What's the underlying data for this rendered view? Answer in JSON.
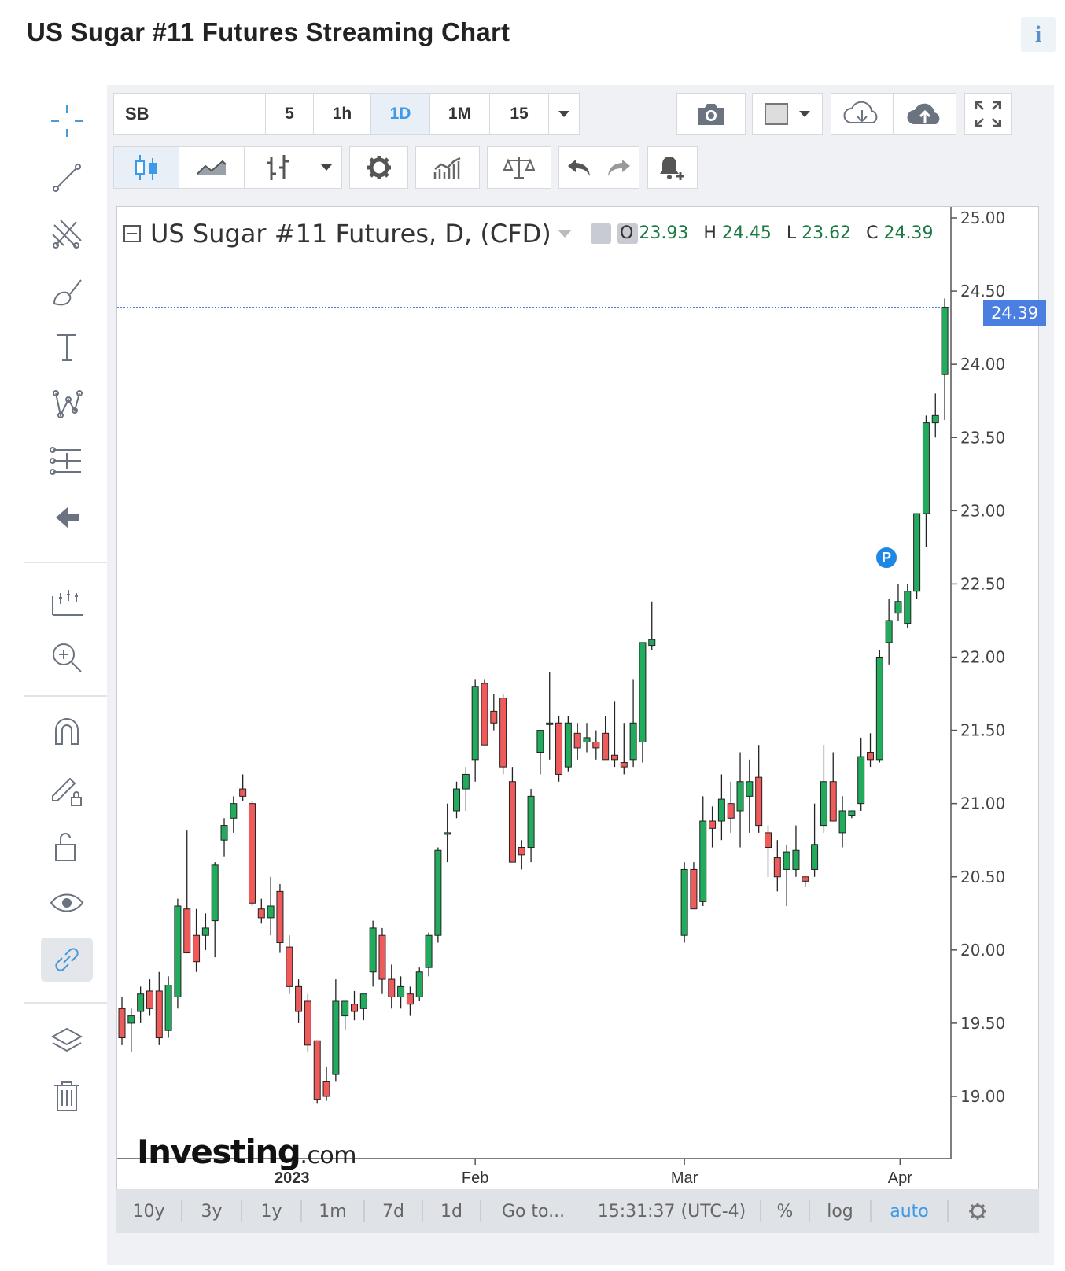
{
  "page": {
    "title": "US Sugar #11 Futures Streaming Chart",
    "info_icon": "i"
  },
  "toolbar": {
    "symbol": "SB",
    "intervals": [
      "5",
      "1h",
      "1D",
      "1M",
      "15"
    ],
    "active_interval": "1D"
  },
  "legend": {
    "title": "US Sugar #11 Futures, D, (CFD)",
    "o_label": "O",
    "o_value": "23.93",
    "h_label": "H",
    "h_value": "24.45",
    "l_label": "L",
    "l_value": "23.62",
    "c_label": "C",
    "c_value": "24.39"
  },
  "price_tag": "24.39",
  "marker_label": "P",
  "watermark": {
    "main": "Investing",
    "suffix": ".com"
  },
  "bottom_bar": {
    "ranges": [
      "10y",
      "3y",
      "1y",
      "1m",
      "7d",
      "1d"
    ],
    "goto": "Go to...",
    "time": "15:31:37 (UTC-4)",
    "percent": "%",
    "log": "log",
    "auto": "auto"
  },
  "colors": {
    "up": "#22ab5c",
    "down": "#ef5b5b",
    "accent": "#3d9ae8",
    "price_tag": "#4a7ee0"
  },
  "chart_data": {
    "type": "candlestick",
    "title": "US Sugar #11 Futures, D, (CFD)",
    "y_tick_labels": [
      "19.00",
      "19.50",
      "20.00",
      "20.50",
      "21.00",
      "21.50",
      "22.00",
      "22.50",
      "23.00",
      "23.50",
      "24.00",
      "24.50",
      "25.00"
    ],
    "x_tick_labels": [
      {
        "label": "2023",
        "value": "2023-01-01"
      },
      {
        "label": "Feb",
        "value": "2023-02-01"
      },
      {
        "label": "Mar",
        "value": "2023-03-01"
      },
      {
        "label": "Apr",
        "value": "2023-04-01"
      }
    ],
    "ylim": [
      18.6,
      25.1
    ],
    "last_price": 24.39,
    "ohlc": [
      [
        19.6,
        19.68,
        19.35,
        19.4
      ],
      [
        19.5,
        19.6,
        19.3,
        19.55
      ],
      [
        19.58,
        19.75,
        19.5,
        19.7
      ],
      [
        19.72,
        19.8,
        19.55,
        19.6
      ],
      [
        19.72,
        19.85,
        19.35,
        19.4
      ],
      [
        19.45,
        19.82,
        19.4,
        19.76
      ],
      [
        19.68,
        20.35,
        19.6,
        20.3
      ],
      [
        20.28,
        20.82,
        20.0,
        19.98
      ],
      [
        20.1,
        20.28,
        19.85,
        19.92
      ],
      [
        20.1,
        20.25,
        20.0,
        20.15
      ],
      [
        20.2,
        20.6,
        19.95,
        20.58
      ],
      [
        20.75,
        20.9,
        20.64,
        20.85
      ],
      [
        20.9,
        21.05,
        20.8,
        21.0
      ],
      [
        21.1,
        21.2,
        21.02,
        21.05
      ],
      [
        21.0,
        21.02,
        20.3,
        20.32
      ],
      [
        20.28,
        20.35,
        20.18,
        20.22
      ],
      [
        20.22,
        20.5,
        20.1,
        20.3
      ],
      [
        20.4,
        20.45,
        19.98,
        20.05
      ],
      [
        20.02,
        20.1,
        19.7,
        19.75
      ],
      [
        19.75,
        19.8,
        19.5,
        19.58
      ],
      [
        19.65,
        19.7,
        19.3,
        19.35
      ],
      [
        19.38,
        19.38,
        18.95,
        18.98
      ],
      [
        19.1,
        19.2,
        18.97,
        19.0
      ],
      [
        19.15,
        19.8,
        19.1,
        19.65
      ],
      [
        19.55,
        19.65,
        19.45,
        19.65
      ],
      [
        19.63,
        19.72,
        19.52,
        19.58
      ],
      [
        19.6,
        19.7,
        19.52,
        19.7
      ],
      [
        19.85,
        20.2,
        19.75,
        20.15
      ],
      [
        20.1,
        20.15,
        19.7,
        19.8
      ],
      [
        19.8,
        19.9,
        19.6,
        19.68
      ],
      [
        19.68,
        19.82,
        19.6,
        19.75
      ],
      [
        19.7,
        19.75,
        19.55,
        19.63
      ],
      [
        19.68,
        19.88,
        19.65,
        19.85
      ],
      [
        19.88,
        20.12,
        19.82,
        20.1
      ],
      [
        20.1,
        20.7,
        20.05,
        20.68
      ],
      [
        20.8,
        21.0,
        20.6,
        20.8
      ],
      [
        20.95,
        21.15,
        20.9,
        21.1
      ],
      [
        21.1,
        21.25,
        20.95,
        21.2
      ],
      [
        21.3,
        21.85,
        21.15,
        21.8
      ],
      [
        21.82,
        21.85,
        21.4,
        21.4
      ],
      [
        21.63,
        21.75,
        21.5,
        21.55
      ],
      [
        21.72,
        21.75,
        21.2,
        21.25
      ],
      [
        21.15,
        21.25,
        20.6,
        20.6
      ],
      [
        20.7,
        20.75,
        20.55,
        20.65
      ],
      [
        20.7,
        21.1,
        20.6,
        21.05
      ],
      [
        21.35,
        21.5,
        21.2,
        21.5
      ],
      [
        21.55,
        21.9,
        21.3,
        21.55
      ],
      [
        21.55,
        21.6,
        21.15,
        21.2
      ],
      [
        21.25,
        21.6,
        21.22,
        21.55
      ],
      [
        21.48,
        21.55,
        21.3,
        21.38
      ],
      [
        21.42,
        21.55,
        21.35,
        21.45
      ],
      [
        21.42,
        21.5,
        21.3,
        21.38
      ],
      [
        21.48,
        21.6,
        21.3,
        21.3
      ],
      [
        21.33,
        21.7,
        21.25,
        21.3
      ],
      [
        21.28,
        21.55,
        21.2,
        21.25
      ],
      [
        21.3,
        21.85,
        21.25,
        21.55
      ],
      [
        21.42,
        22.1,
        21.28,
        22.1
      ],
      [
        22.08,
        22.38,
        22.05,
        22.12
      ],
      [
        20.1,
        20.6,
        20.05,
        20.55
      ],
      [
        20.55,
        20.6,
        20.3,
        20.28
      ],
      [
        20.33,
        21.05,
        20.3,
        20.88
      ],
      [
        20.88,
        20.98,
        20.7,
        20.83
      ],
      [
        20.88,
        21.2,
        20.75,
        21.03
      ],
      [
        21.0,
        21.15,
        20.8,
        20.9
      ],
      [
        20.95,
        21.35,
        20.7,
        21.15
      ],
      [
        21.05,
        21.3,
        20.8,
        21.15
      ],
      [
        21.18,
        21.4,
        20.8,
        20.85
      ],
      [
        20.8,
        20.85,
        20.5,
        20.7
      ],
      [
        20.63,
        20.75,
        20.4,
        20.5
      ],
      [
        20.55,
        20.72,
        20.3,
        20.67
      ],
      [
        20.55,
        20.85,
        20.5,
        20.68
      ],
      [
        20.5,
        20.5,
        20.43,
        20.47
      ],
      [
        20.55,
        21.0,
        20.5,
        20.72
      ],
      [
        20.85,
        21.4,
        20.8,
        21.15
      ],
      [
        21.15,
        21.35,
        20.9,
        20.88
      ],
      [
        20.8,
        21.05,
        20.7,
        20.95
      ],
      [
        20.92,
        20.95,
        20.9,
        20.95
      ],
      [
        21.0,
        21.45,
        20.95,
        21.32
      ],
      [
        21.35,
        21.48,
        21.25,
        21.3
      ],
      [
        21.3,
        22.05,
        21.28,
        22.0
      ],
      [
        22.1,
        22.4,
        21.95,
        22.25
      ],
      [
        22.3,
        22.5,
        22.25,
        22.38
      ],
      [
        22.23,
        22.5,
        22.2,
        22.45
      ],
      [
        22.45,
        22.95,
        22.4,
        22.98
      ],
      [
        22.98,
        23.65,
        22.75,
        23.6
      ],
      [
        23.6,
        23.8,
        23.5,
        23.65
      ],
      [
        23.93,
        24.45,
        23.62,
        24.39
      ]
    ]
  }
}
